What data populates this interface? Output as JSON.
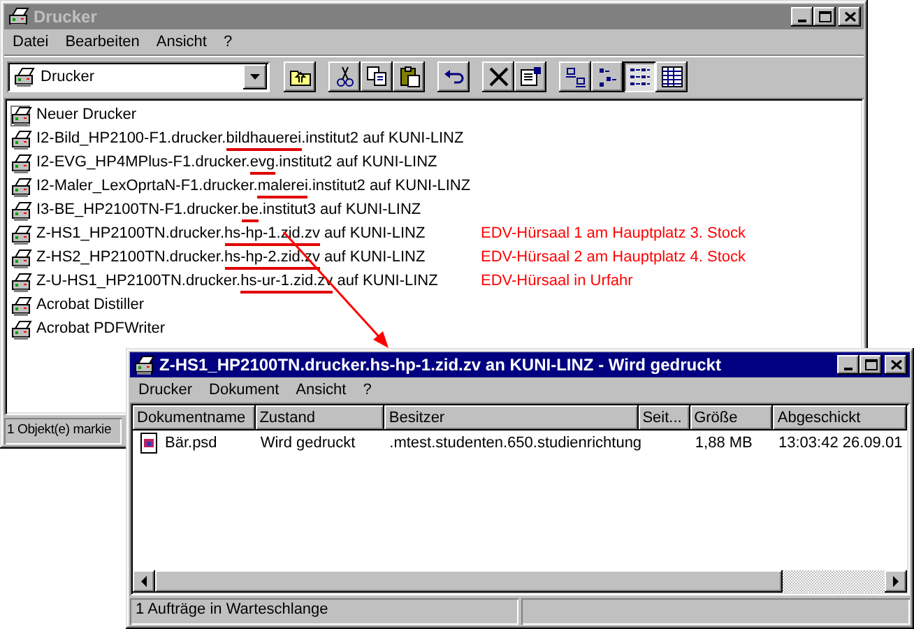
{
  "explorer": {
    "title": "Drucker",
    "menu": [
      "Datei",
      "Bearbeiten",
      "Ansicht",
      "?"
    ],
    "address": "Drucker",
    "view_buttons": [
      {
        "kind": "large",
        "selected": false
      },
      {
        "kind": "small",
        "selected": false
      },
      {
        "kind": "list",
        "selected": true
      },
      {
        "kind": "details",
        "selected": false
      }
    ],
    "items": [
      {
        "kind": "add",
        "name_parts": [
          "Neuer Drucker"
        ]
      },
      {
        "kind": "printer",
        "name_parts": [
          "I2-Bild_HP2100-F1.drucker.",
          "bildhauerei",
          ".institut2 auf KUNI-LINZ"
        ]
      },
      {
        "kind": "printer",
        "name_parts": [
          "I2-EVG_HP4MPlus-F1.drucker.",
          "evg",
          ".institut2 auf KUNI-LINZ"
        ]
      },
      {
        "kind": "printer",
        "name_parts": [
          "I2-Maler_LexOprtaN-F1.drucker.",
          "malerei",
          ".institut2 auf KUNI-LINZ"
        ]
      },
      {
        "kind": "printer",
        "name_parts": [
          "I3-BE_HP2100TN-F1.drucker.",
          "be",
          ".institut3 auf KUNI-LINZ"
        ]
      },
      {
        "kind": "printer",
        "name_parts": [
          "Z-HS1_HP2100TN.drucker.",
          "hs-hp-1.zid.zv",
          " auf KUNI-LINZ"
        ],
        "note": "EDV-Hürsaal 1 am Hauptplatz 3. Stock"
      },
      {
        "kind": "printer",
        "name_parts": [
          "Z-HS2_HP2100TN.drucker.",
          "hs-hp-2.zid.zv",
          " auf KUNI-LINZ"
        ],
        "note": "EDV-Hürsaal 2 am Hauptplatz 4. Stock"
      },
      {
        "kind": "printer",
        "name_parts": [
          "Z-U-HS1_HP2100TN.drucker.",
          "hs-ur-1.zid.zv",
          " auf KUNI-LINZ"
        ],
        "note": "EDV-Hürsaal in Urfahr"
      },
      {
        "kind": "printer",
        "name_parts": [
          "Acrobat Distiller"
        ]
      },
      {
        "kind": "printer",
        "name_parts": [
          "Acrobat PDFWriter"
        ]
      }
    ],
    "status": "1 Objekt(e) markie"
  },
  "queue": {
    "title": "Z-HS1_HP2100TN.drucker.hs-hp-1.zid.zv an KUNI-LINZ - Wird gedruckt",
    "menu": [
      "Drucker",
      "Dokument",
      "Ansicht",
      "?"
    ],
    "columns": [
      "Dokumentname",
      "Zustand",
      "Besitzer",
      "Seit...",
      "Größe",
      "Abgeschickt"
    ],
    "rows": [
      {
        "cells": [
          "Bär.psd",
          "Wird gedruckt",
          ".mtest.studenten.650.studienrichtung",
          "",
          "1,88 MB",
          "13:03:42  26.09.01"
        ]
      }
    ],
    "status": "1 Aufträge in Warteschlange"
  }
}
